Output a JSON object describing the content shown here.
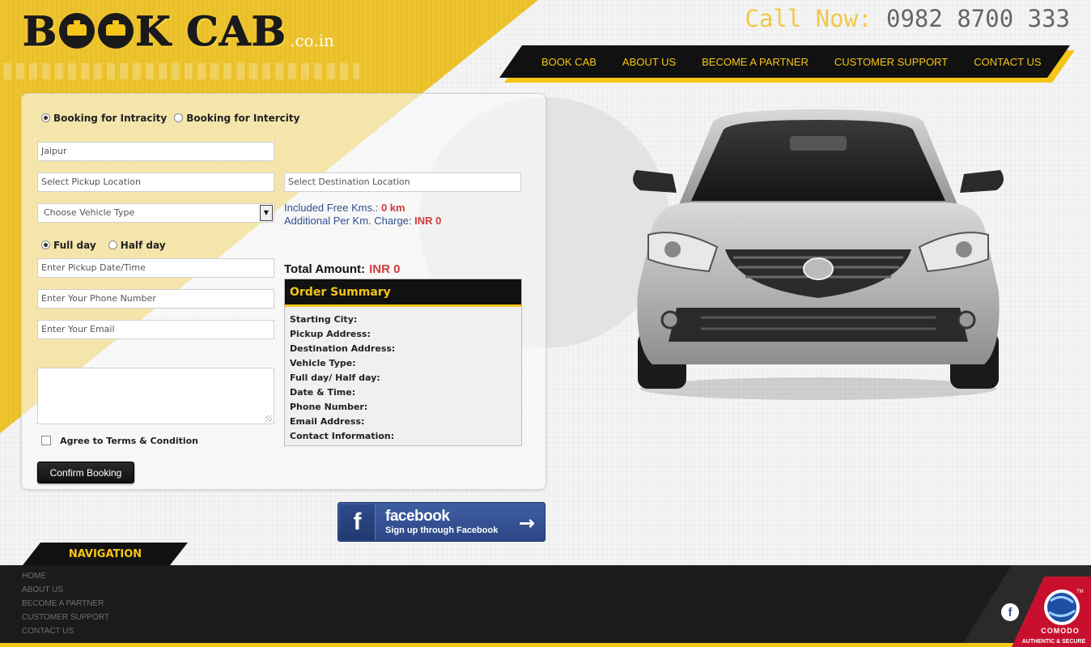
{
  "brand": {
    "logo_b": "B",
    "logo_k": "K CAB",
    "domain": ".co.in"
  },
  "header": {
    "call_label": "Call Now:",
    "phone": "0982 8700 333"
  },
  "nav": {
    "items": [
      "BOOK CAB",
      "ABOUT US",
      "BECOME A PARTNER",
      "CUSTOMER SUPPORT",
      "CONTACT US"
    ]
  },
  "form": {
    "booking_intracity": "Booking for Intracity",
    "booking_intercity": "Booking for Intercity",
    "city_value": "Jaipur",
    "pickup_location_placeholder": "Select Pickup Location",
    "destination_location_placeholder": "Select Destination Location",
    "vehicle_type": "Choose Vehicle Type",
    "free_kms_label": "Included Free Kms.:",
    "free_kms_value": "0 km",
    "per_km_label": "Additional Per Km. Charge:",
    "per_km_value": "INR 0",
    "full_day": "Full day",
    "half_day": "Half day",
    "pickup_datetime_placeholder": "Enter Pickup Date/Time",
    "phone_placeholder": "Enter Your Phone Number",
    "email_placeholder": "Enter Your Email",
    "total_label": "Total Amount:",
    "total_value": "INR 0",
    "terms": "Agree to Terms & Condition",
    "confirm": "Confirm Booking"
  },
  "summary": {
    "title": "Order Summary",
    "rows": [
      "Starting City:",
      "Pickup Address:",
      "Destination Address:",
      "Vehicle Type:",
      "Full day/ Half day:",
      "Date & Time:",
      "Phone Number:",
      "Email Address:",
      "Contact Information:"
    ]
  },
  "facebook": {
    "letter": "f",
    "title": "facebook",
    "subtitle": "Sign up through Facebook",
    "arrow": "→"
  },
  "footer": {
    "nav_title": "NAVIGATION",
    "links": [
      "HOME",
      "ABOUT US",
      "BECOME A PARTNER",
      "CUSTOMER SUPPORT",
      "CONTACT US"
    ],
    "fb_letter": "f",
    "comodo_name": "COMODO",
    "comodo_tag": "AUTHENTIC & SECURE",
    "comodo_tm": "TM"
  },
  "colors": {
    "brand_yellow": "#f5c518",
    "dark": "#111111",
    "price_red": "#d23b3b",
    "info_blue": "#2f4f8f"
  },
  "icons": [
    "taxi-icon",
    "radio-icon",
    "dropdown-arrow-icon",
    "checkbox-icon",
    "facebook-icon",
    "arrow-right-icon",
    "comodo-seal-icon",
    "car-image"
  ]
}
